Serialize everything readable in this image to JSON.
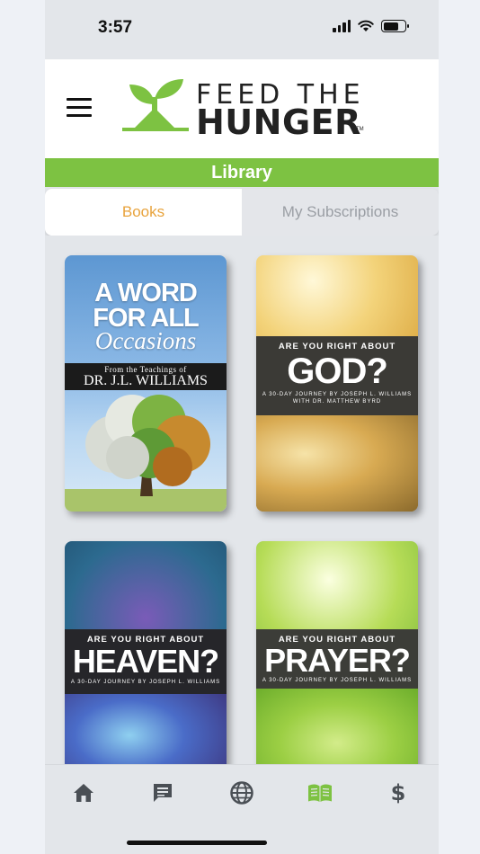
{
  "status": {
    "time": "3:57"
  },
  "logo": {
    "line1": "FEED THE",
    "line2": "HUNGER",
    "tm": "TM"
  },
  "library": {
    "title": "Library"
  },
  "tabs": {
    "books": "Books",
    "subscriptions": "My Subscriptions",
    "active": "Books"
  },
  "books": [
    {
      "line1": "A WORD",
      "line2": "FOR ALL",
      "line3": "Occasions",
      "strip_top": "From the Teachings of",
      "strip_bottom": "DR. J.L. WILLIAMS"
    },
    {
      "pre": "ARE YOU RIGHT ABOUT",
      "title": "GOD?",
      "sub1": "A 30-DAY JOURNEY BY JOSEPH L. WILLIAMS",
      "sub2": "WITH DR. MATTHEW BYRD"
    },
    {
      "pre": "ARE YOU RIGHT ABOUT",
      "title": "HEAVEN?",
      "sub1": "A 30-DAY JOURNEY BY JOSEPH L. WILLIAMS"
    },
    {
      "pre": "ARE YOU RIGHT ABOUT",
      "title": "PRAYER?",
      "sub1": "A 30-DAY JOURNEY BY JOSEPH L. WILLIAMS"
    }
  ],
  "tabbar": {
    "items": [
      "home-icon",
      "chat-icon",
      "globe-icon",
      "book-icon",
      "dollar-icon"
    ],
    "active": "book-icon",
    "dollar_glyph": "$"
  },
  "colors": {
    "brand_green": "#7dc242",
    "tab_active_text": "#e8a33c",
    "icon_gray": "#4a4f55"
  }
}
